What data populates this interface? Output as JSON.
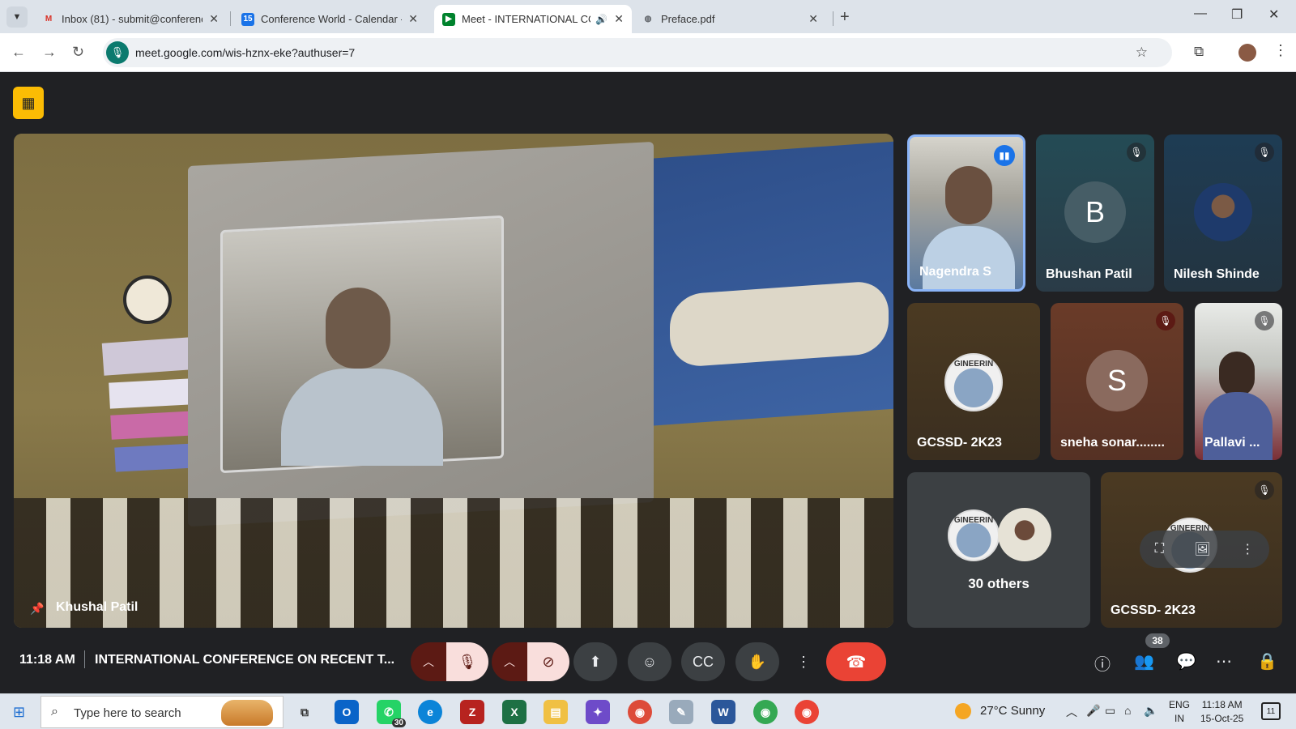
{
  "browser": {
    "tabs": [
      {
        "title": "Inbox (81) - submit@conferenc",
        "favicon": "gmail-icon"
      },
      {
        "title": "Conference World - Calendar -",
        "favicon": "calendar-icon"
      },
      {
        "title": "Meet - INTERNATIONAL CO",
        "favicon": "meet-icon",
        "active": true
      },
      {
        "title": "Preface.pdf",
        "favicon": "globe-icon"
      }
    ],
    "url": "meet.google.com/wis-hznx-eke?authuser=7"
  },
  "meet": {
    "main_speaker": "Khushal Patil",
    "participants": [
      {
        "name": "Nagendra S",
        "type": "video",
        "speaking": true
      },
      {
        "name": "Bhushan Patil",
        "type": "letter",
        "letter": "B",
        "muted": true
      },
      {
        "name": "Nilesh Shinde",
        "type": "photo",
        "muted": true
      },
      {
        "name": "GCSSD- 2K23",
        "type": "logo",
        "logo_text": "GINEERIN"
      },
      {
        "name": "sneha sonar........",
        "type": "letter",
        "letter": "S",
        "muted": true
      },
      {
        "name": "Pallavi ...",
        "type": "video",
        "muted": true
      },
      {
        "name": "30 others",
        "type": "group",
        "logo_text": "GINEERIN"
      },
      {
        "name": "GCSSD- 2K23",
        "type": "logo",
        "logo_text": "GINEERIN",
        "muted": true
      }
    ],
    "clock": "11:18 AM",
    "meeting_title": "INTERNATIONAL CONFERENCE ON RECENT T...",
    "people_count": "38"
  },
  "taskbar": {
    "search_placeholder": "Type here to search",
    "whatsapp_count": "30",
    "temperature": "27°C",
    "weather": "Sunny",
    "lang_top": "ENG",
    "lang_bottom": "IN",
    "time": "11:18 AM",
    "date": "15-Oct-25",
    "notifications": "11"
  },
  "colors": {
    "meet_bg": "#202124",
    "end_call": "#ea4335",
    "muted_control": "#f9dedc",
    "active_speaker_border": "#8ab4f8"
  }
}
